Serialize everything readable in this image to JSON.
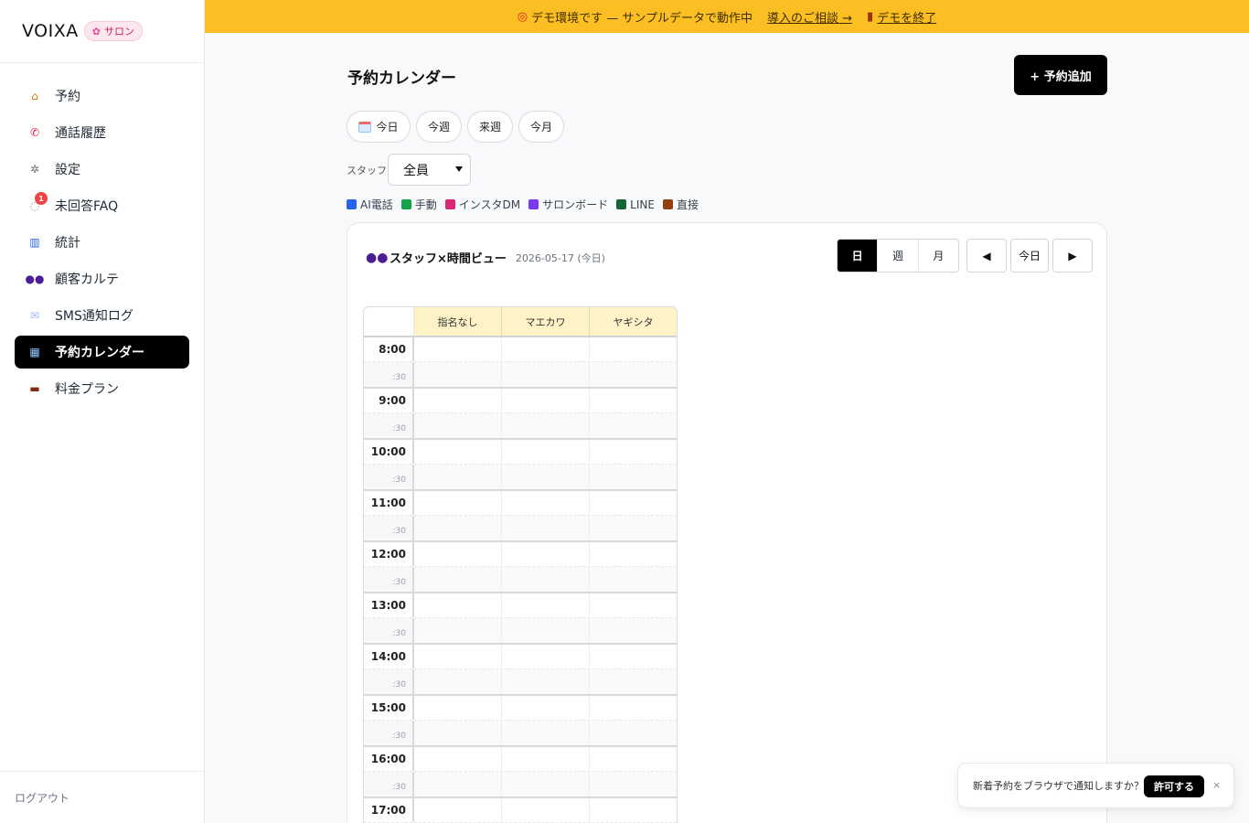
{
  "sidebar": {
    "brand": "VOIXA",
    "badge": "サロン",
    "items": [
      {
        "label": "予約",
        "icon": "house-icon"
      },
      {
        "label": "通話履歴",
        "icon": "phone-icon"
      },
      {
        "label": "設定",
        "icon": "gear-icon"
      },
      {
        "label": "未回答FAQ",
        "icon": "speech-bubble-icon",
        "badge": "1"
      },
      {
        "label": "統計",
        "icon": "bar-chart-icon"
      },
      {
        "label": "顧客カルテ",
        "icon": "people-icon"
      },
      {
        "label": "SMS通知ログ",
        "icon": "envelope-icon"
      },
      {
        "label": "予約カレンダー",
        "icon": "calendar-icon",
        "active": true
      },
      {
        "label": "料金プラン",
        "icon": "briefcase-icon"
      }
    ],
    "logout": "ログアウト"
  },
  "banner": {
    "text": "デモ環境です — サンプルデータで動作中",
    "consult_link": "導入のご相談 →",
    "end_link": "デモを終了",
    "color": "#fbbf24"
  },
  "header": {
    "title": "予約カレンダー",
    "add_button": "+ 予約追加"
  },
  "quick_ranges": [
    "今日",
    "今週",
    "来週",
    "今月"
  ],
  "staff_filter": {
    "label": "スタッフ:",
    "value": "全員"
  },
  "legend": [
    {
      "label": "AI電話",
      "color": "#2563eb"
    },
    {
      "label": "手動",
      "color": "#16a34a"
    },
    {
      "label": "インスタDM",
      "color": "#db2777"
    },
    {
      "label": "サロンボード",
      "color": "#7c3aed"
    },
    {
      "label": "LINE",
      "color": "#166534"
    },
    {
      "label": "直接",
      "color": "#92400e"
    }
  ],
  "calendar": {
    "view_title": "スタッフ×時間ビュー",
    "date": "2026-05-17 (今日)",
    "modes": [
      "日",
      "週",
      "月"
    ],
    "active_mode": "日",
    "prev": "◀",
    "today": "今日",
    "next": "▶",
    "columns": [
      "指名なし",
      "マエカワ",
      "ヤギシタ"
    ],
    "hours": [
      "8:00",
      "9:00",
      "10:00",
      "11:00",
      "12:00",
      "13:00",
      "14:00",
      "15:00",
      "16:00",
      "17:00"
    ],
    "half_label": ":30"
  },
  "toast": {
    "text": "新着予約をブラウザで通知しますか？",
    "allow": "許可する",
    "close": "×"
  }
}
